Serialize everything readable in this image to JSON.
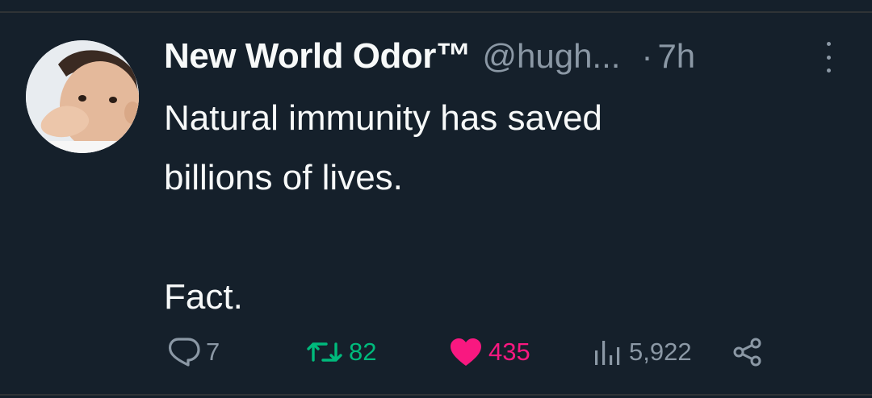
{
  "tweet": {
    "display_name": "New World Odor™",
    "handle": "@hugh...",
    "separator": "·",
    "time": "7h",
    "text_lines": [
      "Natural immunity has saved",
      "billions of lives."
    ],
    "text_last": "Fact."
  },
  "actions": {
    "reply_count": "7",
    "retweet_count": "82",
    "like_count": "435",
    "views_count": "5,922"
  },
  "icons": {
    "reply": "reply-bubble-icon",
    "retweet": "retweet-icon",
    "like": "heart-icon",
    "views": "views-bar-chart-icon",
    "share": "share-icon",
    "more": "more-vertical-icon"
  },
  "colors": {
    "background": "#15202b",
    "text": "#f7f9f9",
    "muted": "#8b98a5",
    "retweet": "#00ba7c",
    "like": "#f91880"
  }
}
